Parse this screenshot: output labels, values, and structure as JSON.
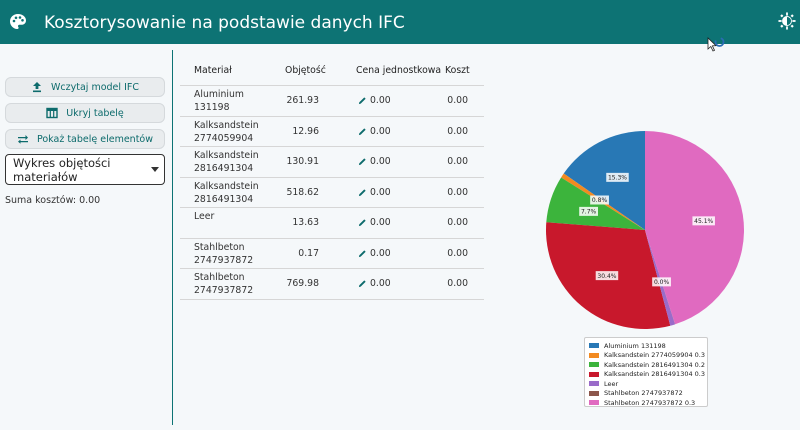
{
  "app": {
    "title": "Kosztorysowanie na podstawie danych IFC"
  },
  "sidebar": {
    "buttons": [
      {
        "label": "Wczytaj model IFC",
        "icon": "upload-icon"
      },
      {
        "label": "Ukryj tabelę",
        "icon": "table-icon"
      },
      {
        "label": "Pokaż tabelę elementów",
        "icon": "swap-icon"
      }
    ],
    "chart_select": "Wykres objętości materiałów",
    "total_cost": "Suma kosztów: 0.00"
  },
  "table": {
    "headers": {
      "material": "Materiał",
      "volume": "Objętość",
      "unit_price": "Cena jednostkowa",
      "cost": "Koszt"
    },
    "rows": [
      {
        "material": "Aluminium\n131198",
        "volume": "261.93",
        "price": "0.00",
        "cost": "0.00"
      },
      {
        "material": "Kalksandstein\n2774059904\n0.3",
        "volume": "12.96",
        "price": "0.00",
        "cost": "0.00"
      },
      {
        "material": "Kalksandstein\n2816491304\n0.2",
        "volume": "130.91",
        "price": "0.00",
        "cost": "0.00"
      },
      {
        "material": "Kalksandstein\n2816491304\n0.3",
        "volume": "518.62",
        "price": "0.00",
        "cost": "0.00"
      },
      {
        "material": "Leer",
        "volume": "13.63",
        "price": "0.00",
        "cost": "0.00"
      },
      {
        "material": "Stahlbeton\n2747937872",
        "volume": "0.17",
        "price": "0.00",
        "cost": "0.00"
      },
      {
        "material": "Stahlbeton\n2747937872\n0.3",
        "volume": "769.98",
        "price": "0.00",
        "cost": "0.00"
      }
    ]
  },
  "chart_data": {
    "type": "pie",
    "categories": [
      "Aluminium 131198",
      "Kalksandstein 2774059904 0.3",
      "Kalksandstein 2816491304 0.2",
      "Kalksandstein 2816491304 0.3",
      "Leer",
      "Stahlbeton 2747937872",
      "Stahlbeton 2747937872 0.3"
    ],
    "values": [
      261.93,
      12.96,
      130.91,
      518.62,
      13.63,
      0.17,
      769.98
    ],
    "labels": [
      "15.3%",
      "0.8%",
      "7.7%",
      "30.4%",
      "",
      "0.0%",
      "45.1%"
    ],
    "colors": [
      "#2878b5",
      "#f28a20",
      "#3cb43c",
      "#c8182c",
      "#9a6bc9",
      "#8c564b",
      "#e06ac0"
    ],
    "legend": "bottom"
  }
}
